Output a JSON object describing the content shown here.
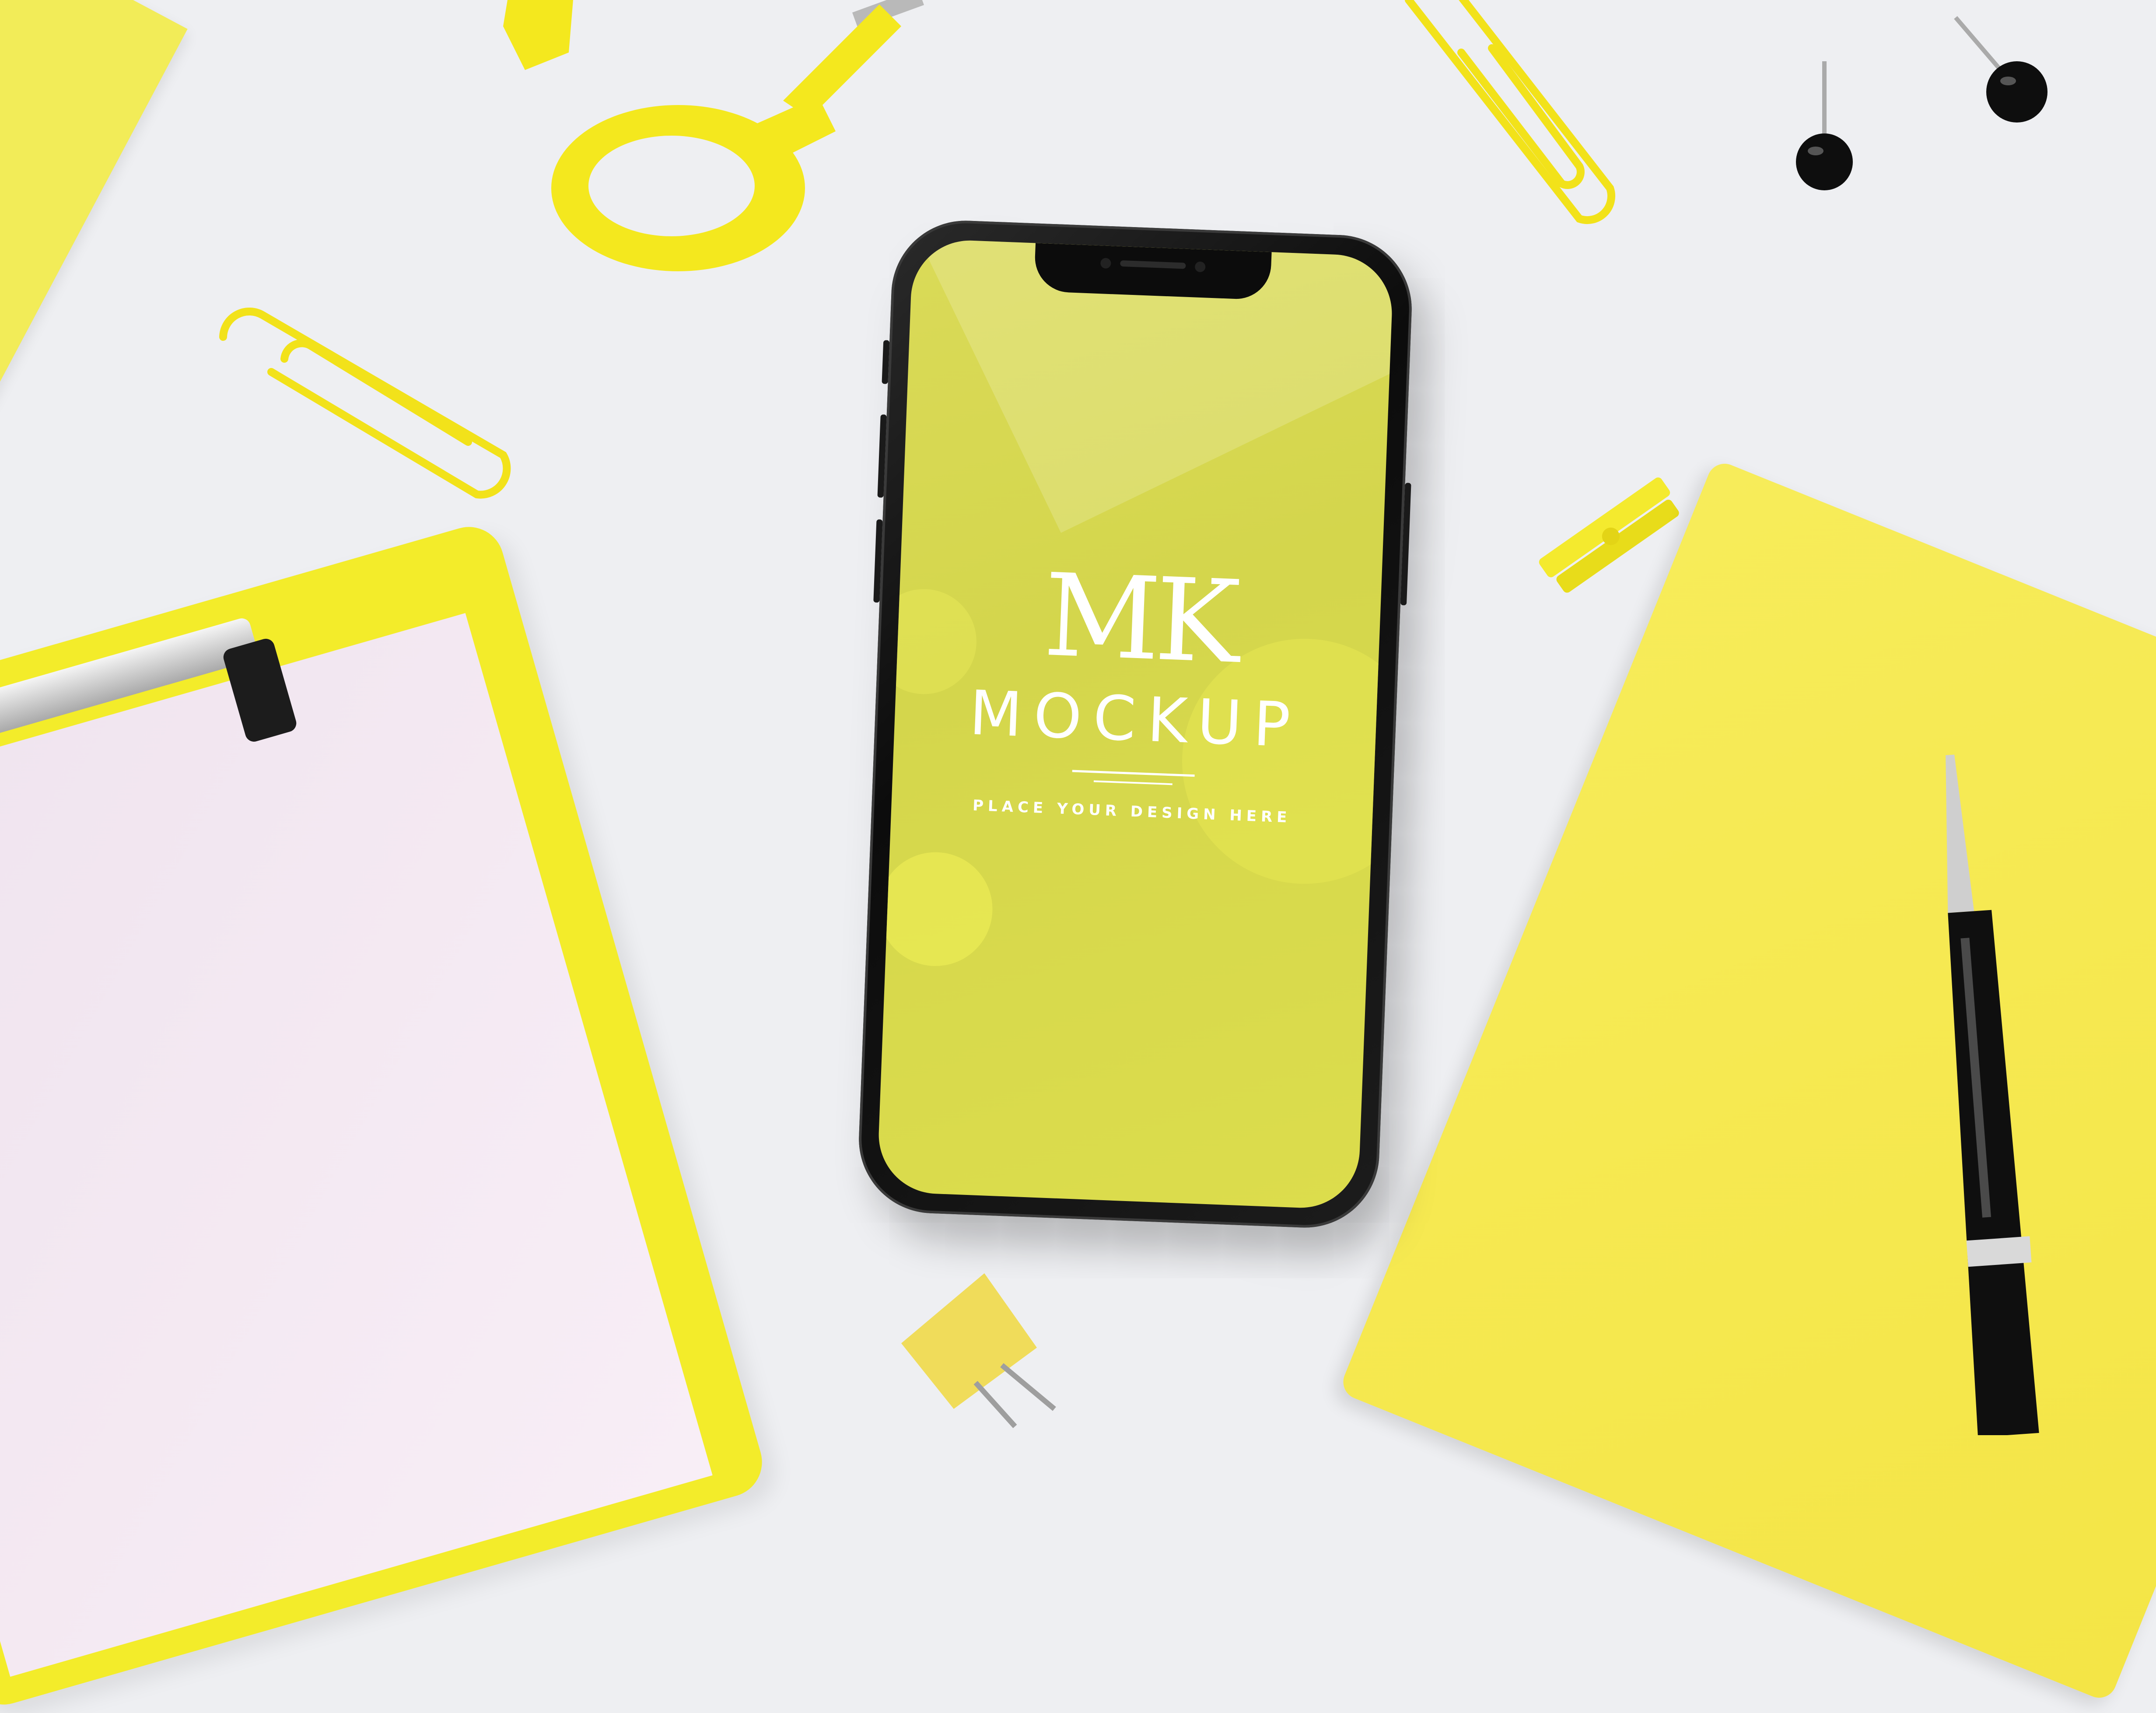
{
  "colors": {
    "background": "#eeeff2",
    "accent_yellow": "#f2ec22",
    "notebook_yellow": "#f5ea56",
    "screen_yellow": "#d8d94f",
    "paper_pink": "#f3e7f1",
    "black": "#111111",
    "white": "#ffffff"
  },
  "screen": {
    "monogram": "MK",
    "wordmark": "MOCKUP",
    "tagline": "PLACE YOUR DESIGN HERE"
  },
  "objects": [
    "yellow-folder",
    "yellow-scissors",
    "yellow-paperclip",
    "black-push-pin",
    "smartphone",
    "yellow-clothespin",
    "yellow-clipboard",
    "yellow-notebook",
    "black-pen",
    "yellow-binder-clip"
  ]
}
